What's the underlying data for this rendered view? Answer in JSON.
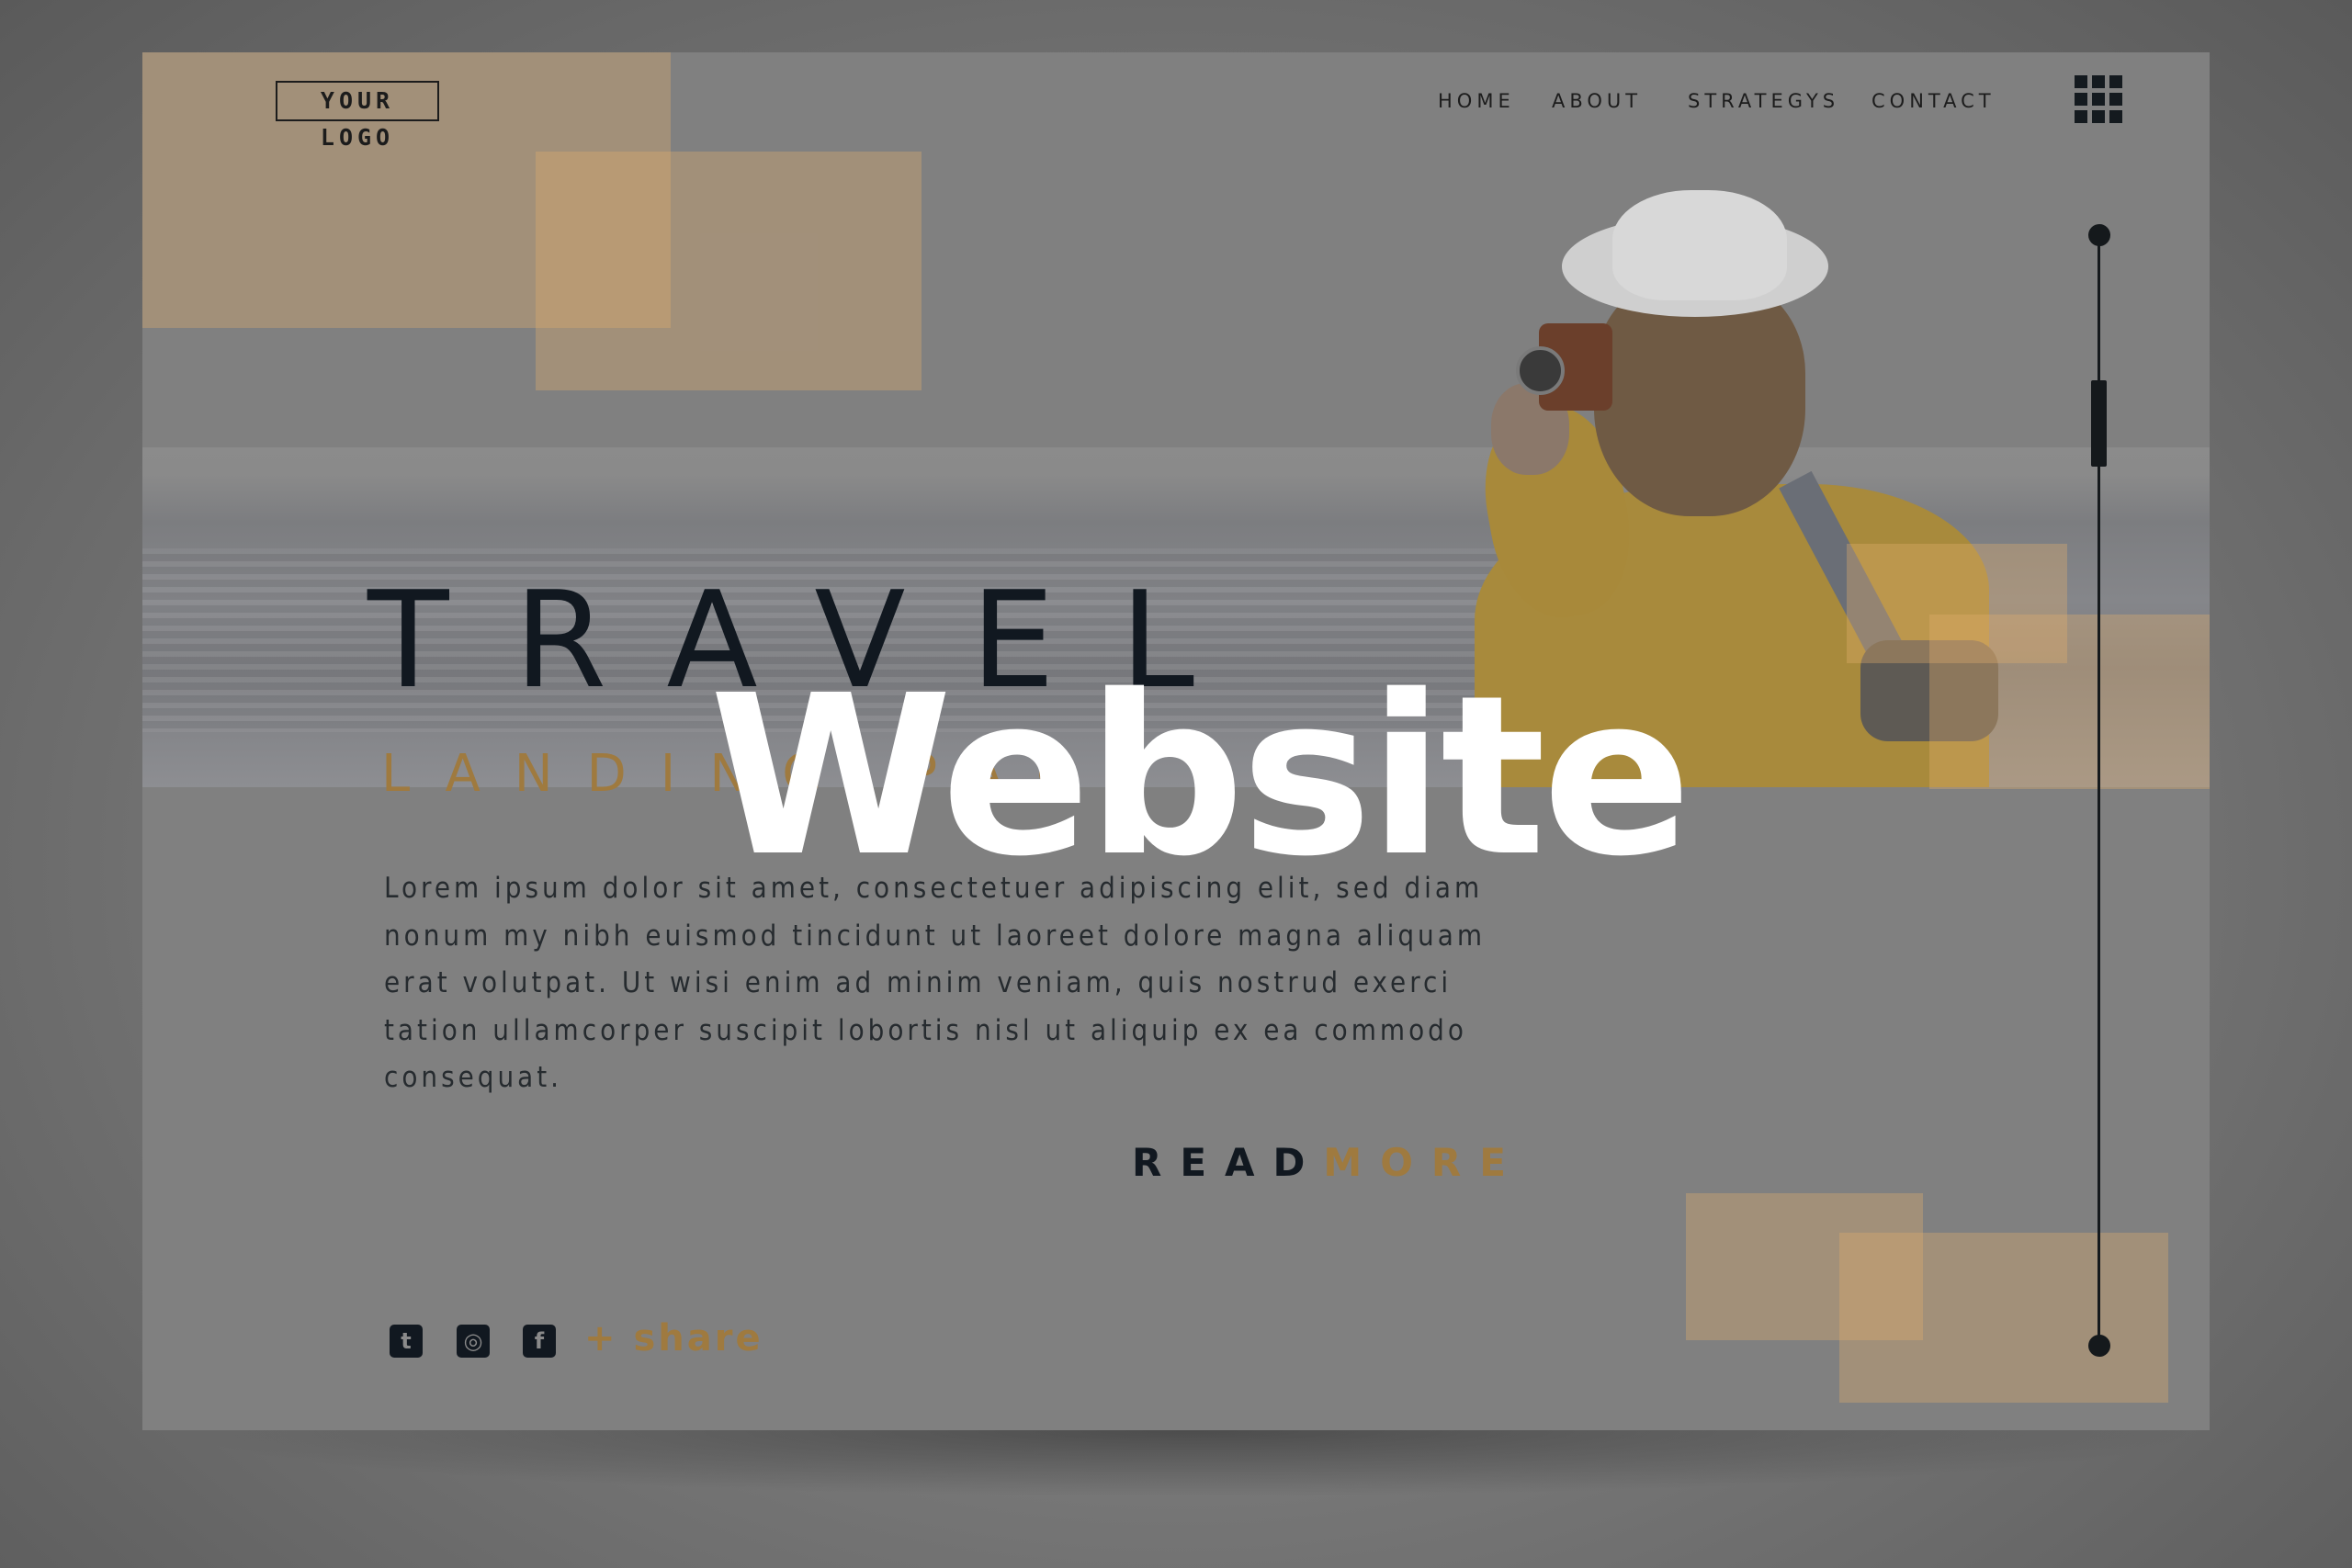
{
  "logo": {
    "text": "YOUR LOGO"
  },
  "nav": {
    "items": [
      "HOME",
      "ABOUT",
      "STRATEGYS",
      "CONTACT"
    ]
  },
  "hero": {
    "title": "TRAVEL",
    "subtitle": "LANDING PAGE",
    "body": "Lorem ipsum dolor sit amet, consectetuer adipiscing elit, sed diam nonum my nibh euismod tincidunt ut laoreet dolore magna aliquam erat volutpat. Ut wisi enim ad minim veniam, quis nostrud exerci tation ullamcorper suscipit lobortis nisl ut aliquip ex ea commodo consequat.",
    "read": "READ",
    "more": "MORE"
  },
  "social": {
    "twitter": "t",
    "instagram": "◎",
    "facebook": "f",
    "share": "+ share"
  },
  "overlay": {
    "text": "Website"
  },
  "colors": {
    "accent": "#9f7a3f",
    "dark": "#111820",
    "peach": "#e1af6e"
  },
  "icons": [
    "grid-menu-icon",
    "twitter-icon",
    "instagram-icon",
    "facebook-icon"
  ]
}
